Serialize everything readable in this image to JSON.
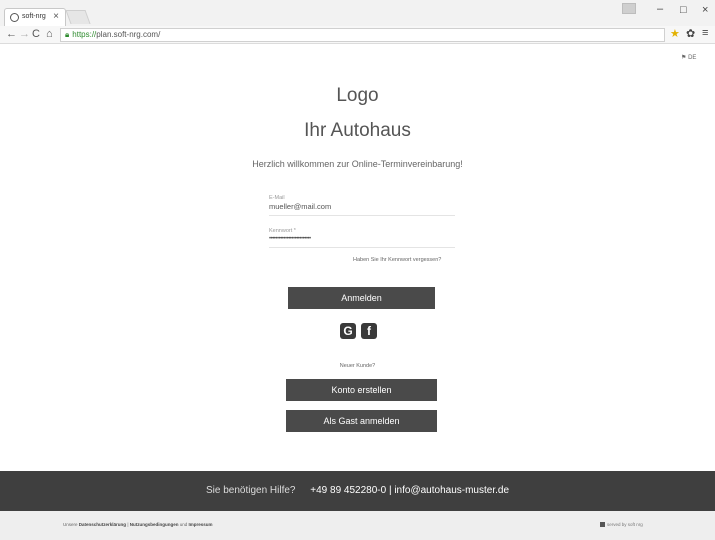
{
  "browser": {
    "tab_title": "soft-nrg",
    "tab_close": "×",
    "url_secure_part": "https://",
    "url_rest": "plan.soft-nrg.com/",
    "window_min": "–",
    "window_max": "□",
    "window_close": "×",
    "back": "←",
    "forward": "→",
    "reload": "C",
    "home": "⌂",
    "star": "★",
    "extension": "✿",
    "menu": "≡"
  },
  "page": {
    "language": "DE",
    "logo": "Logo",
    "company": "Ihr Autohaus",
    "welcome": "Herzlich willkommen zur Online-Terminvereinbarung!",
    "email_label": "E-Mail",
    "email_value": "mueller@mail.com",
    "password_label": "Kennwort *",
    "password_value": "••••••••••••••••••••••••••",
    "forgot_link": "Haben Sie Ihr Kennwort vergessen?",
    "login_button": "Anmelden",
    "social_google": "G",
    "social_facebook": "f",
    "new_customer": "Neuer Kunde?",
    "register_button": "Konto erstellen",
    "guest_button": "Als Gast anmelden"
  },
  "footer": {
    "help_text": "Sie benötigen Hilfe?",
    "contact_text": "+49 89 452280-0 | info@autohaus-muster.de",
    "legal_prefix": "Unsere",
    "legal_privacy": "Datenschutzerklärung",
    "legal_sep1": "|",
    "legal_terms": "Nutzungsbedingungen",
    "legal_and": "und",
    "legal_imprint": "Impressum",
    "powered_by": "served by soft nrg"
  }
}
